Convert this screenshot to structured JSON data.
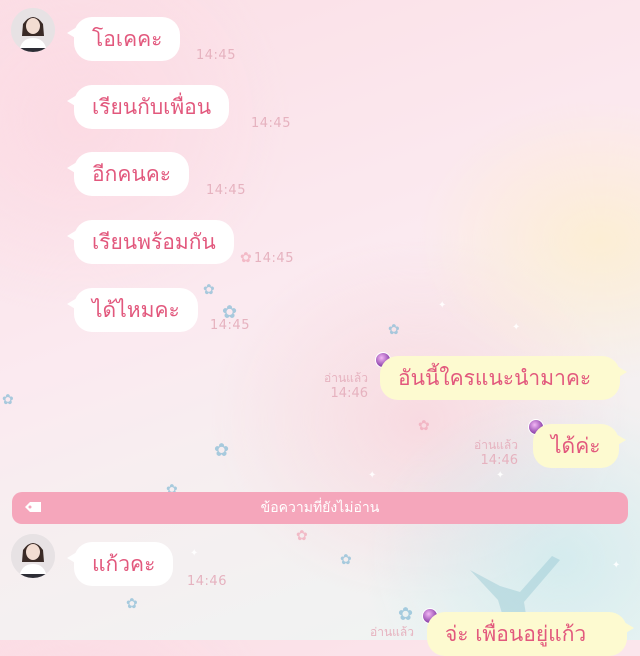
{
  "colors": {
    "accent_text": "#e2587d",
    "incoming_bubble": "#ffffff",
    "outgoing_bubble": "#fdfad0",
    "timestamp": "#e6b2bf",
    "unread_bar": "#f5a6bb"
  },
  "icons": {
    "unread_tag": "tag-icon",
    "read_sticker": "grape-icon"
  },
  "messages": [
    {
      "direction": "incoming",
      "text": "โอเคคะ",
      "time": "14:45"
    },
    {
      "direction": "incoming",
      "text": "เรียนกับเพื่อน",
      "time": "14:45"
    },
    {
      "direction": "incoming",
      "text": "อีกคนคะ",
      "time": "14:45"
    },
    {
      "direction": "incoming",
      "text": "เรียนพร้อมกัน",
      "time": "14:45"
    },
    {
      "direction": "incoming",
      "text": "ได้ไหมคะ",
      "time": "14:45"
    },
    {
      "direction": "outgoing",
      "text": "อันนี้ใครแนะนำมาคะ",
      "read_label": "อ่านแล้ว",
      "time": "14:46"
    },
    {
      "direction": "outgoing",
      "text": "ได้ค่ะ",
      "read_label": "อ่านแล้ว",
      "time": "14:46"
    },
    {
      "direction": "incoming",
      "text": "แก้วคะ",
      "time": "14:46"
    },
    {
      "direction": "outgoing",
      "text": "จ่ะ เพื่อนอยู่แก้ว",
      "read_label": "อ่านแล้ว",
      "time": ""
    }
  ],
  "unread_divider": {
    "label": "ข้อความที่ยังไม่อ่าน"
  }
}
